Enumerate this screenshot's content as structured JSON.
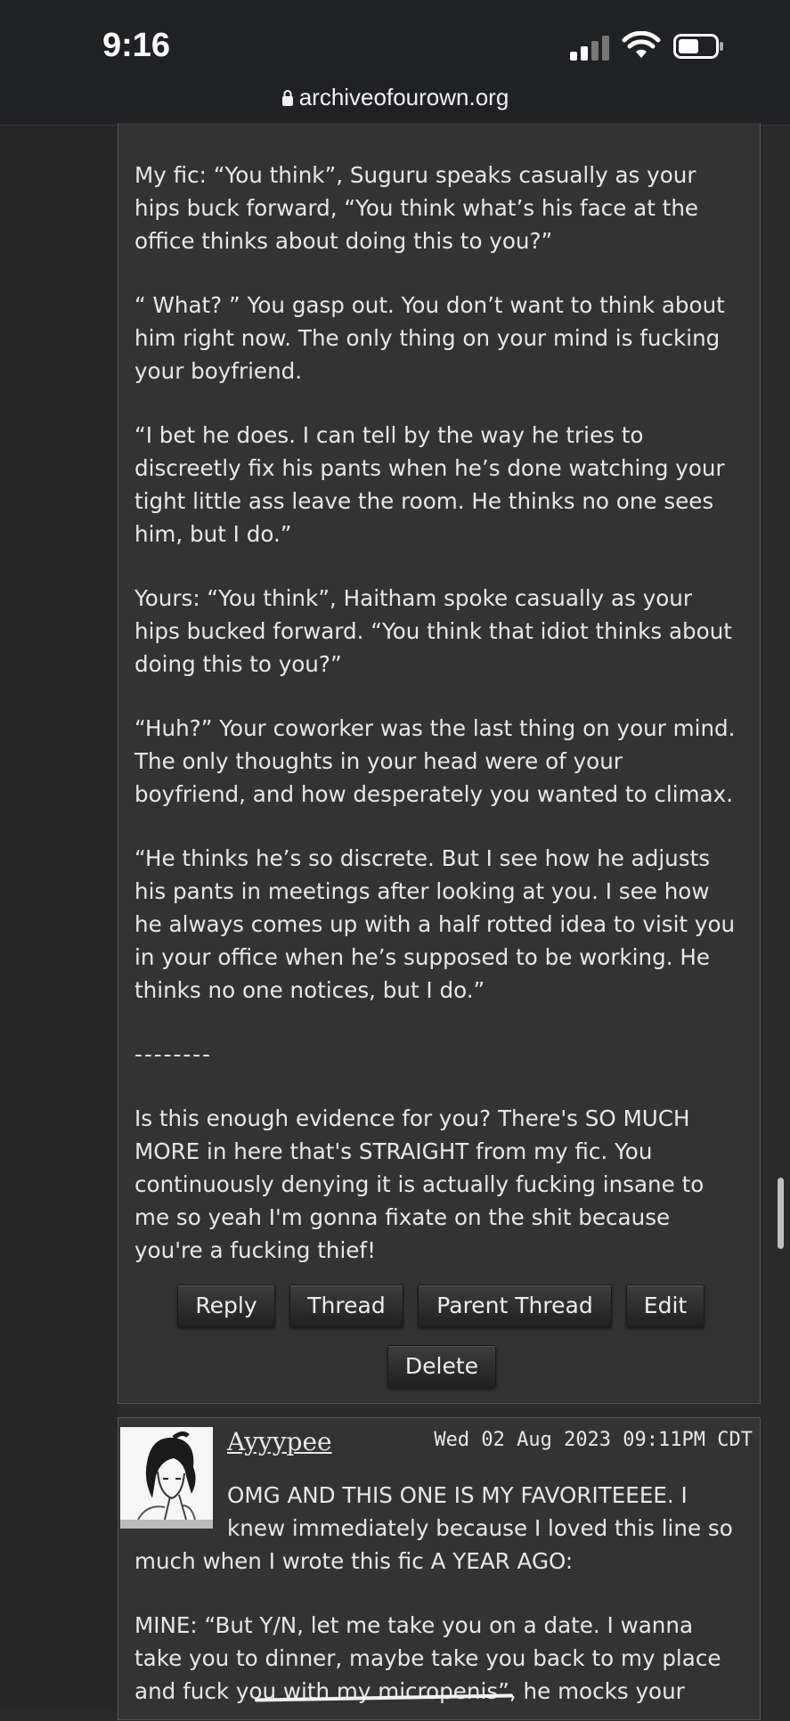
{
  "status": {
    "time": "9:16",
    "url": "archiveofourown.org"
  },
  "comment1": {
    "paragraphs": [
      "My fic: “You think”, Suguru speaks casually as your hips buck forward, “You think what’s his face at the office thinks about doing this to you?”",
      "“ What? ” You gasp out. You don’t want to think about him right now. The only thing on your mind is fucking your boyfriend.",
      "“I bet he does. I can tell by the way he tries to discreetly fix his pants when he’s done watching your tight little ass leave the room. He thinks no one sees him, but I do.”",
      "Yours: “You think”, Haitham spoke casually as your hips bucked forward. “You think that idiot thinks about doing this to you?”",
      "“Huh?” Your coworker was the last thing on your mind. The only thoughts in your head were of your boyfriend, and how desperately you wanted to climax.",
      "“He thinks he’s so discrete. But I see how he adjusts his pants in meetings after looking at you. I see how he always comes up with a half rotted idea to visit you in your office when he’s supposed to be working. He thinks no one notices, but I do.”",
      "--------",
      "Is this enough evidence for you? There's SO MUCH MORE in here that's STRAIGHT from my fic. You continuously denying it is actually fucking insane to me so yeah I'm gonna fixate on the shit because you're a fucking thief!"
    ],
    "buttons": {
      "reply": "Reply",
      "thread": "Thread",
      "parent_thread": "Parent Thread",
      "edit": "Edit",
      "delete": "Delete"
    }
  },
  "comment2": {
    "username": "Ayyypee",
    "date": "Wed 02 Aug 2023 09:11PM CDT",
    "lines": [
      "OMG AND THIS ONE IS MY FAVORITEEEE. I",
      "knew immediately because I loved this line so",
      "much when I wrote this fic A YEAR AGO:",
      "MINE: “But Y/N, let me take you on a date. I wanna",
      "take you to dinner, maybe take you back to my place",
      "and fuck you with my micropenis”, he mocks your"
    ]
  }
}
